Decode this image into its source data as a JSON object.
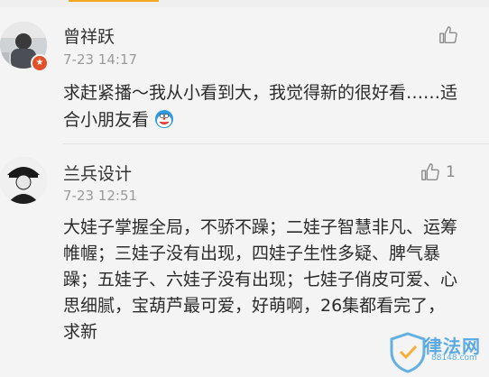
{
  "comments": [
    {
      "username": "曾祥跃",
      "timestamp": "7-23 14:17",
      "badge_icon": "verified-badge-icon",
      "like_icon": "thumbs-up-icon",
      "like_count": "",
      "text": "求赶紧播～我从小看到大，我觉得新的很好看……适合小朋友看",
      "emoji_icon": "doraemon-emoji-icon"
    },
    {
      "username": "兰兵设计",
      "timestamp": "7-23 12:51",
      "like_icon": "thumbs-up-icon",
      "like_count": "1",
      "text": "大娃子掌握全局，不骄不躁；二娃子智慧非凡、运筹帷幄；三娃子没有出现，四娃子生性多疑、脾气暴躁；五娃子、六娃子没有出现；七娃子俏皮可爱、心思细腻，宝葫芦最可爱，好萌啊，26集都看完了，求新"
    }
  ],
  "watermark": {
    "text": "律法网",
    "sub": "88148.com"
  },
  "colors": {
    "accent_top": "#f5a623",
    "badge": "#e0502b",
    "watermark": "#4aa3df"
  }
}
